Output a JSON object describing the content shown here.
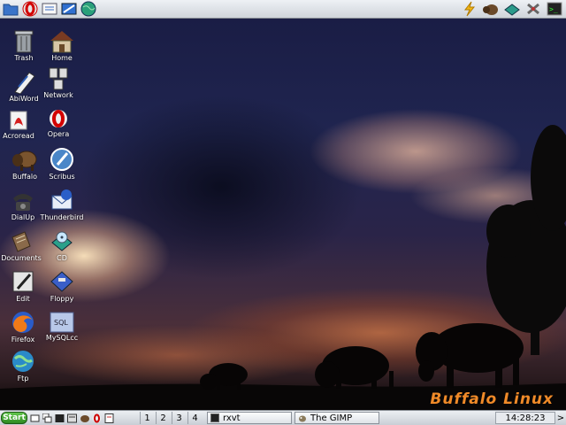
{
  "top_panel": {
    "launchers": [
      "home-folder-icon",
      "opera-icon",
      "notes-icon",
      "image-editor-icon",
      "globe-icon"
    ],
    "tray": [
      "lightning-icon",
      "buffalo-icon",
      "scanner-icon",
      "tools-icon",
      "terminal-icon"
    ]
  },
  "desktop": {
    "icons": [
      {
        "label": "Trash",
        "icon": "trash-icon"
      },
      {
        "label": "Home",
        "icon": "home-icon"
      },
      {
        "label": "AbiWord",
        "icon": "abiword-icon"
      },
      {
        "label": "Network",
        "icon": "network-icon"
      },
      {
        "label": "Acroread",
        "icon": "acroread-icon"
      },
      {
        "label": "Opera",
        "icon": "opera-icon"
      },
      {
        "label": "Buffalo",
        "icon": "buffalo-icon"
      },
      {
        "label": "Scribus",
        "icon": "scribus-icon"
      },
      {
        "label": "DialUp",
        "icon": "telephone-icon"
      },
      {
        "label": "Thunderbird",
        "icon": "thunderbird-icon"
      },
      {
        "label": "Documents",
        "icon": "documents-icon"
      },
      {
        "label": "CD",
        "icon": "cd-icon"
      },
      {
        "label": "Edit",
        "icon": "edit-icon"
      },
      {
        "label": "Floppy",
        "icon": "floppy-icon"
      },
      {
        "label": "Firefox",
        "icon": "firefox-icon"
      },
      {
        "label": "MySQLcc",
        "icon": "mysql-icon",
        "glyph_text": "SQL"
      },
      {
        "label": "Ftp",
        "icon": "ftp-globe-icon"
      }
    ],
    "brand": "Buffalo Linux"
  },
  "taskbar": {
    "start_label": "Start",
    "quick_launch": [
      "show-desktop-icon",
      "windows-icon",
      "terminal-icon",
      "file-manager-icon",
      "buffalo-icon",
      "opera-icon",
      "text-editor-icon"
    ],
    "desktops": [
      "1",
      "2",
      "3",
      "4"
    ],
    "tasks": [
      {
        "label": "rxvt",
        "icon": "terminal-icon"
      },
      {
        "label": "The GIMP",
        "icon": "gimp-icon"
      }
    ],
    "clock": "14:28:23",
    "arrow": ">"
  },
  "colors": {
    "brand": "#f08a28",
    "start_button": "#3fa02e",
    "panel": "#dde1e6"
  }
}
